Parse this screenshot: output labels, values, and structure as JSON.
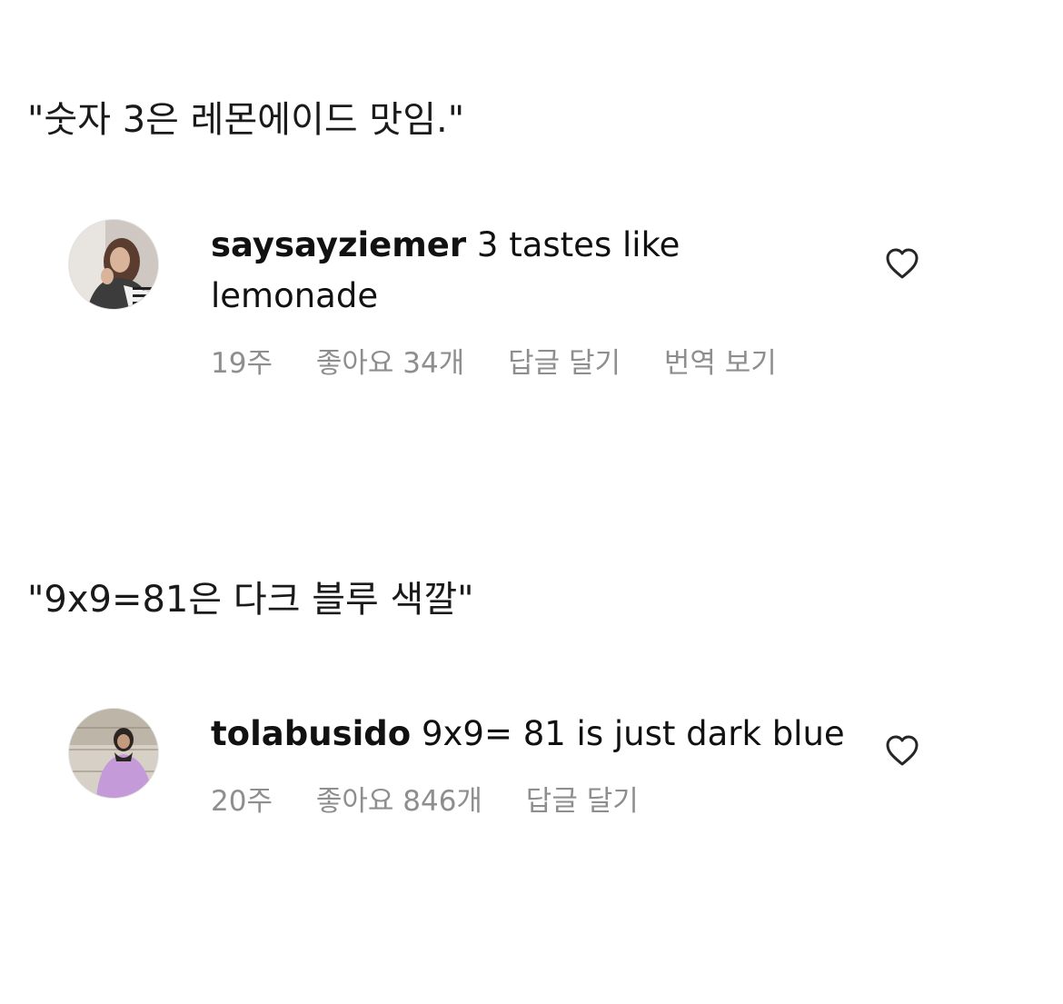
{
  "captions": [
    "\"숫자 3은 레몬에이드 맛임.\"",
    "\"9x9=81은 다크 블루 색깔\""
  ],
  "comments": [
    {
      "username": "saysayziemer",
      "text": " 3 tastes like lemonade",
      "time": "19주",
      "likes": "좋아요 34개",
      "reply_label": "답글 달기",
      "translate_label": "번역 보기",
      "avatar_icon": "profile-photo",
      "like_icon": "heart-outline-icon"
    },
    {
      "username": "tolabusido",
      "text": " 9x9= 81 is just dark blue",
      "time": "20주",
      "likes": "좋아요 846개",
      "reply_label": "답글 달기",
      "avatar_icon": "profile-photo",
      "like_icon": "heart-outline-icon"
    }
  ],
  "colors": {
    "text": "#111111",
    "meta": "#8e8e8e",
    "background": "#ffffff"
  }
}
